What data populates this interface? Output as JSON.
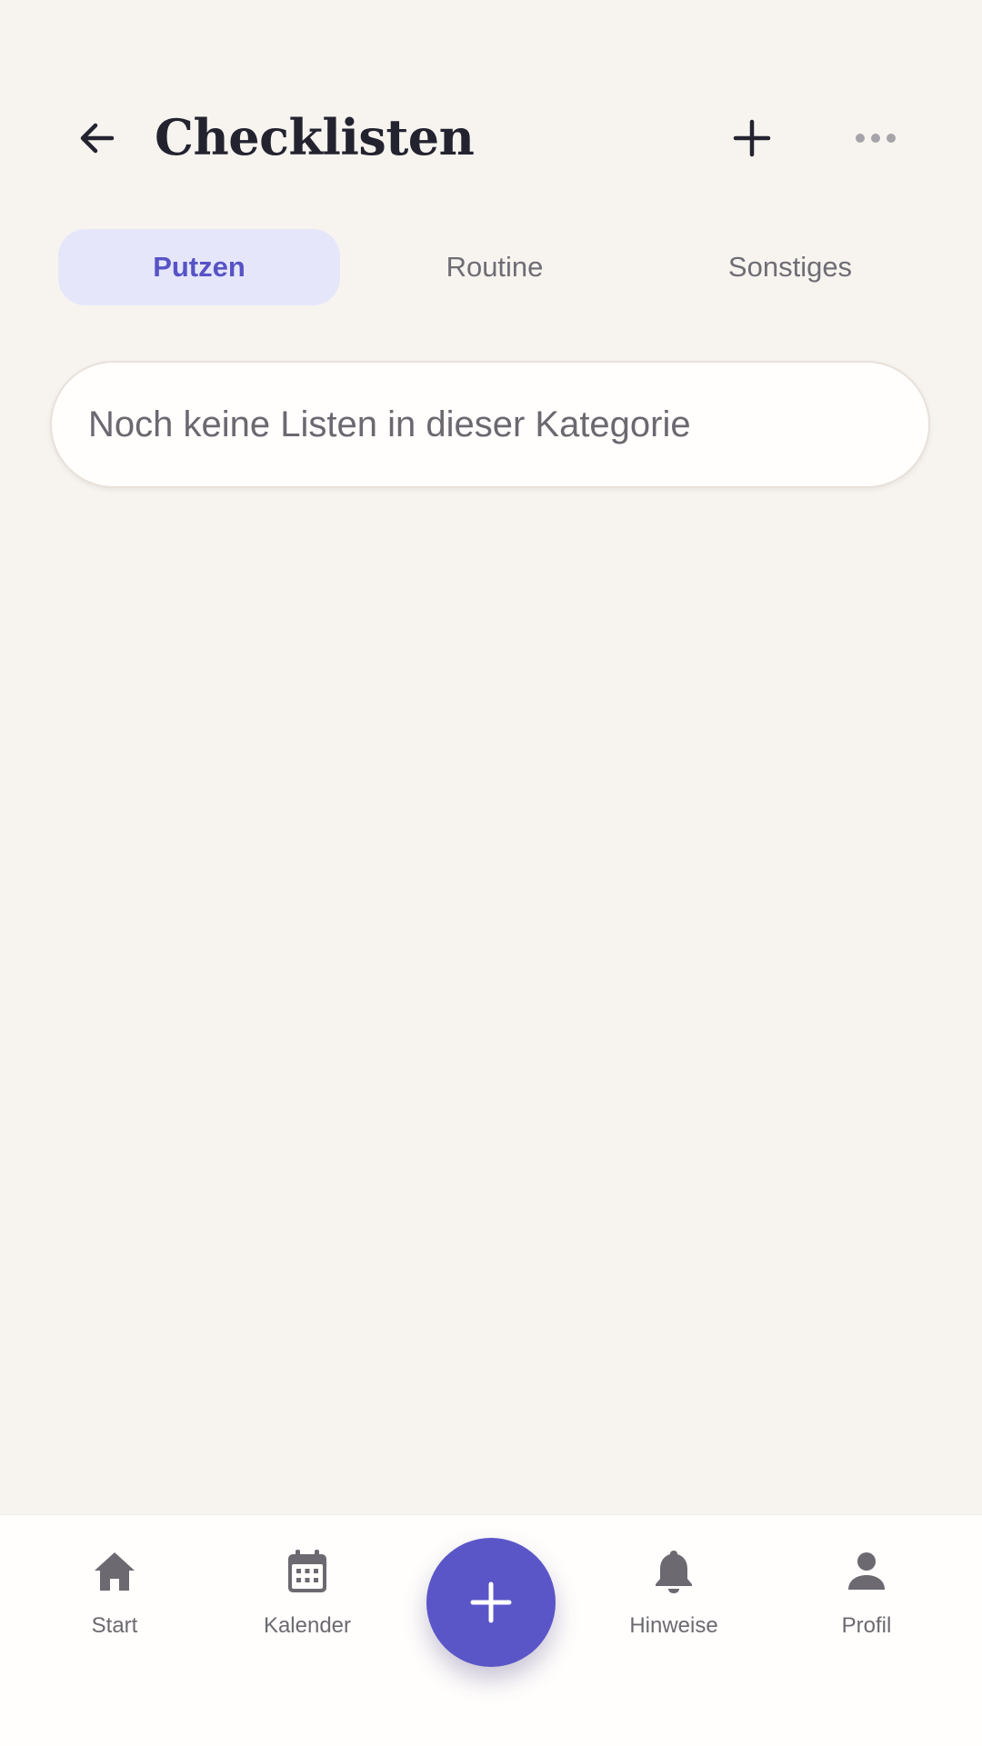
{
  "header": {
    "title": "Checklisten",
    "back_icon": "arrow-left-icon",
    "add_icon": "plus-icon",
    "more_icon": "more-horizontal-icon"
  },
  "tabs": [
    {
      "label": "Putzen",
      "active": true
    },
    {
      "label": "Routine",
      "active": false
    },
    {
      "label": "Sonstiges",
      "active": false
    }
  ],
  "empty_state": {
    "message": "Noch keine Listen in dieser Kategorie"
  },
  "bottom_nav": {
    "items": [
      {
        "label": "Start",
        "icon": "home-icon"
      },
      {
        "label": "Kalender",
        "icon": "calendar-icon"
      },
      {
        "label": "Hinweise",
        "icon": "bell-icon"
      },
      {
        "label": "Profil",
        "icon": "person-icon"
      }
    ],
    "fab_icon": "plus-icon"
  },
  "colors": {
    "background": "#f7f4f0",
    "accent": "#5a56c8",
    "active_tab_bg": "#e6e6fb",
    "active_tab_text": "#5753c6",
    "muted_text": "#6c6a70",
    "title_text": "#232330"
  }
}
